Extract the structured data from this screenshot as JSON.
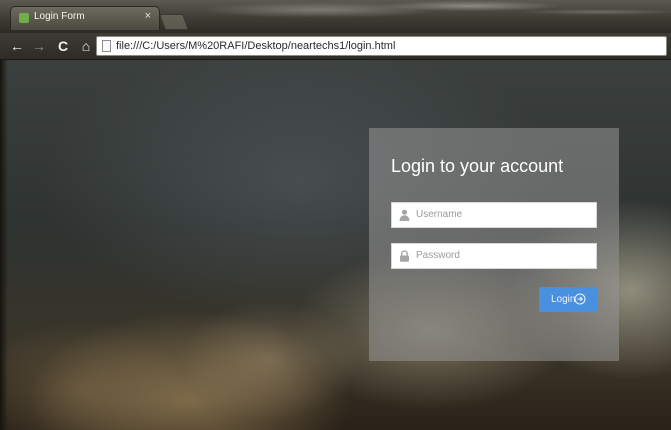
{
  "browser": {
    "tab": {
      "title": "Login Form",
      "close_glyph": "×",
      "favicon": "page-favicon-icon"
    },
    "toolbar": {
      "back_glyph": "←",
      "forward_glyph": "→",
      "reload_glyph": "C",
      "home_glyph": "⌂",
      "url": "file:///C:/Users/M%20RAFI/Desktop/neartechs1/login.html"
    }
  },
  "login": {
    "title": "Login to your account",
    "username": {
      "placeholder": "Username",
      "value": "",
      "icon": "user-icon"
    },
    "password": {
      "placeholder": "Password",
      "value": "",
      "icon": "lock-icon"
    },
    "button": {
      "label": "Login",
      "icon": "arrow-right-circle-icon"
    }
  },
  "colors": {
    "button_accent": "#4a90e0",
    "panel_overlay": "#969696",
    "field_background": "#ffffff"
  }
}
